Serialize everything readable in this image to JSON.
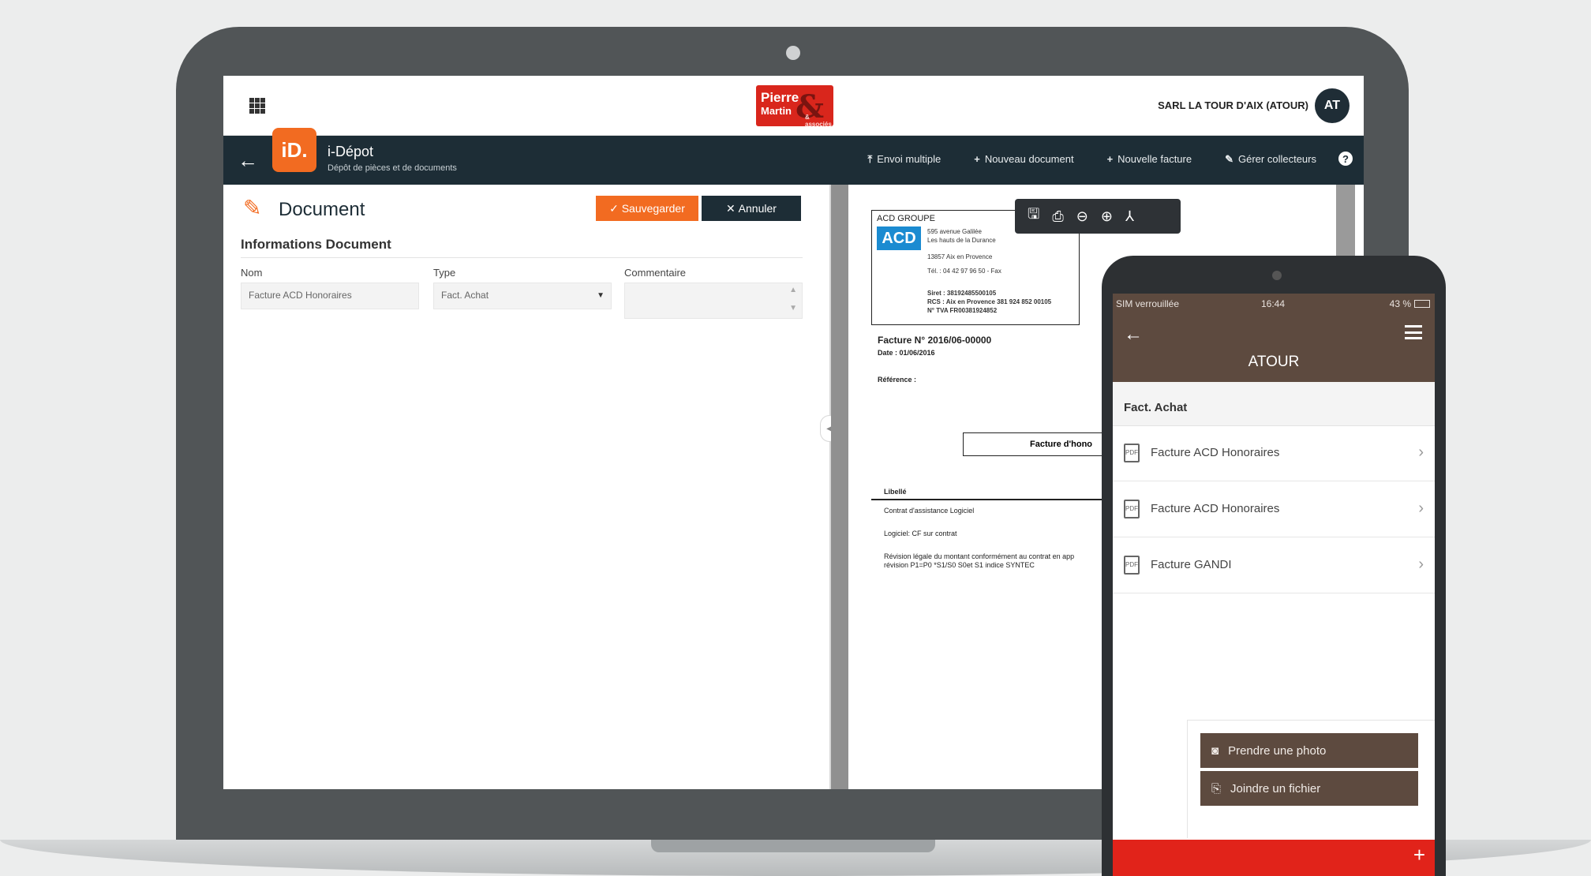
{
  "header": {
    "brand_line1": "Pierre",
    "brand_line2": "Martin",
    "brand_line3": "& associés",
    "company": "SARL LA TOUR D'AIX (ATOUR)",
    "avatar_initials": "AT"
  },
  "nav": {
    "app_badge": "iD.",
    "app_title": "i-Dépot",
    "app_subtitle": "Dépôt de pièces et de documents",
    "actions": [
      {
        "icon": "upload-icon",
        "label": "Envoi multiple"
      },
      {
        "icon": "plus-icon",
        "label": "Nouveau document"
      },
      {
        "icon": "plus-icon",
        "label": "Nouvelle facture"
      },
      {
        "icon": "edit-icon",
        "label": "Gérer collecteurs"
      }
    ],
    "help": "?"
  },
  "form": {
    "title": "Document",
    "save_label": "Sauvegarder",
    "cancel_label": "Annuler",
    "section": "Informations Document",
    "nom_label": "Nom",
    "nom_value": "Facture ACD Honoraires",
    "type_label": "Type",
    "type_value": "Fact. Achat",
    "commentaire_label": "Commentaire",
    "commentaire_value": ""
  },
  "pdf": {
    "company": "ACD GROUPE",
    "logo_text": "ACD",
    "addr1": "595 avenue Galilée",
    "addr2": "Les hauts de la Durance",
    "addr3": "13857 Aix en Provence",
    "addr4": "Tél. : 04 42 97 96 50  - Fax",
    "addr5": "Siret : 38192485500105",
    "addr6": "RCS : Aix en Provence 381 924 852 00105",
    "addr7": "N° TVA FR00381924852",
    "invoice_no": "Facture N° 2016/06-00000",
    "date": "Date : 01/06/2016",
    "reference": "Référence :",
    "box_label": "Facture d'hono",
    "libelle": "Libellé",
    "line1": "Contrat d'assistance Logiciel",
    "line2": "Logiciel: CF sur contrat",
    "line3": "Révision légale du montant conformément au contrat en app",
    "line4": "révision P1=P0 *S1/S0          S0et S1 indice SYNTEC"
  },
  "phone": {
    "status_left": "SIM verrouillée",
    "status_time": "16:44",
    "status_right": "43 %",
    "title": "ATOUR",
    "section": "Fact. Achat",
    "items": [
      "Facture ACD Honoraires",
      "Facture ACD Honoraires",
      "Facture GANDI"
    ],
    "photo_label": "Prendre une photo",
    "file_label": "Joindre un fichier",
    "fab": "+"
  },
  "colors": {
    "accent": "#f26b21",
    "navy": "#1d2d36",
    "brown": "#5d4a3f",
    "red": "#e1231a"
  }
}
